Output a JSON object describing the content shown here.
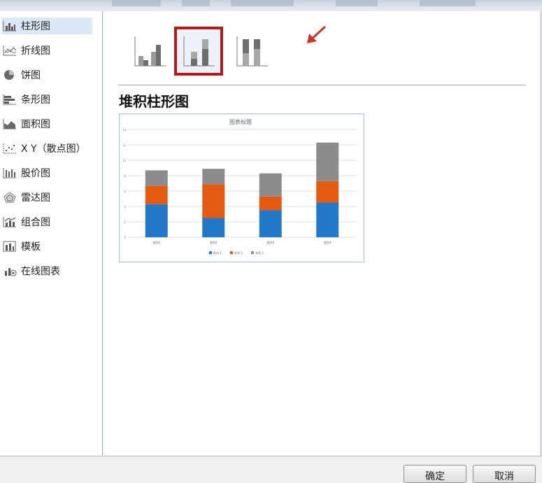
{
  "sidebar": {
    "items": [
      {
        "label": "柱形图",
        "icon": "column-chart-icon"
      },
      {
        "label": "折线图",
        "icon": "line-chart-icon"
      },
      {
        "label": "饼图",
        "icon": "pie-chart-icon"
      },
      {
        "label": "条形图",
        "icon": "bar-chart-icon"
      },
      {
        "label": "面积图",
        "icon": "area-chart-icon"
      },
      {
        "label": "X Y（散点图）",
        "icon": "scatter-chart-icon"
      },
      {
        "label": "股价图",
        "icon": "stock-chart-icon"
      },
      {
        "label": "雷达图",
        "icon": "radar-chart-icon"
      },
      {
        "label": "组合图",
        "icon": "combo-chart-icon"
      },
      {
        "label": "模板",
        "icon": "template-icon"
      },
      {
        "label": "在线图表",
        "icon": "online-chart-icon"
      }
    ],
    "selected_index": 0
  },
  "subtypes": {
    "items": [
      {
        "icon": "clustered-column-icon"
      },
      {
        "icon": "stacked-column-icon"
      },
      {
        "icon": "100-stacked-column-icon"
      }
    ],
    "selected_index": 1
  },
  "main": {
    "type_title": "堆积柱形图"
  },
  "colors": {
    "highlight": "#b01c1c",
    "series1": "#2478c8",
    "series2": "#e35a12",
    "series3": "#8c8c8c"
  },
  "chart_data": {
    "type": "bar",
    "stacked": true,
    "title": "图表标题",
    "categories": [
      "类别1",
      "类别2",
      "类别3",
      "类别4"
    ],
    "series": [
      {
        "name": "系列 1",
        "values": [
          4.3,
          2.5,
          3.5,
          4.5
        ]
      },
      {
        "name": "系列 2",
        "values": [
          2.4,
          4.4,
          1.8,
          2.8
        ]
      },
      {
        "name": "系列 3",
        "values": [
          2.0,
          2.0,
          3.0,
          5.0
        ]
      }
    ],
    "ylim": [
      0,
      14
    ],
    "yticks": [
      "0",
      "2",
      "4",
      "6",
      "8",
      "10",
      "12",
      "14"
    ],
    "legend_position": "bottom",
    "grid": true
  },
  "footer": {
    "ok_label": "确定",
    "cancel_label": "取消"
  }
}
